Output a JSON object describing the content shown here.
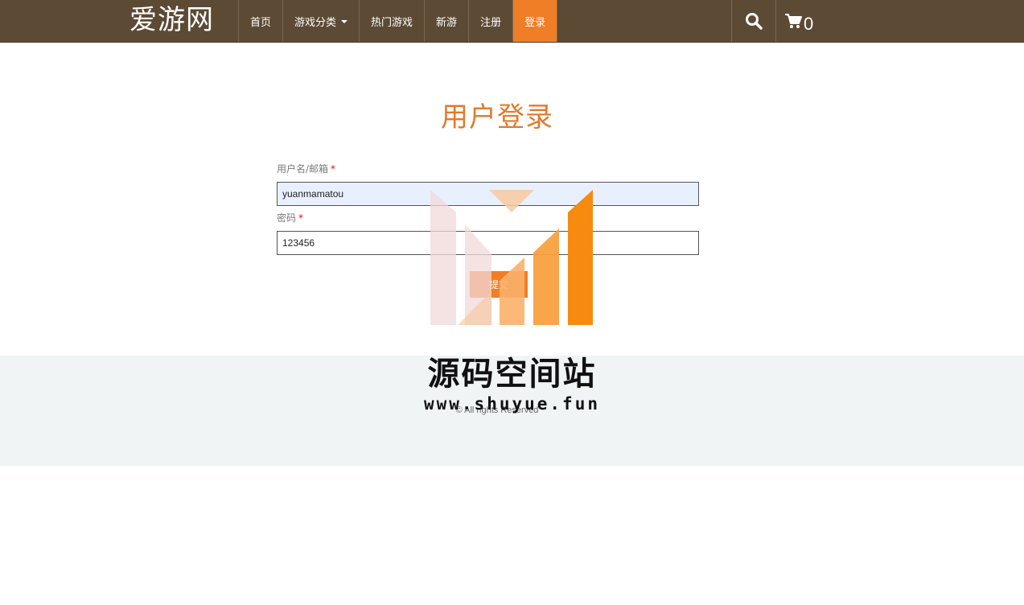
{
  "header": {
    "logo": "爱游网",
    "nav": [
      {
        "label": "首页"
      },
      {
        "label": "游戏分类"
      },
      {
        "label": "热门游戏"
      },
      {
        "label": "新游"
      },
      {
        "label": "注册"
      },
      {
        "label": "登录",
        "active": true
      }
    ],
    "cart_count": "0",
    "colors": {
      "bar": "#5c4a34",
      "active": "#f07e26"
    }
  },
  "login": {
    "title": "用户登录",
    "username_label": "用户名/邮箱",
    "username_value": "yuanmamatou",
    "password_label": "密码",
    "password_value": "123456",
    "required_mark": "*",
    "submit_label": "提交"
  },
  "footer": {
    "copyright": "© All rights Reserved"
  },
  "watermark": {
    "title": "源码空间站",
    "url": "www.shuyue.fun"
  }
}
